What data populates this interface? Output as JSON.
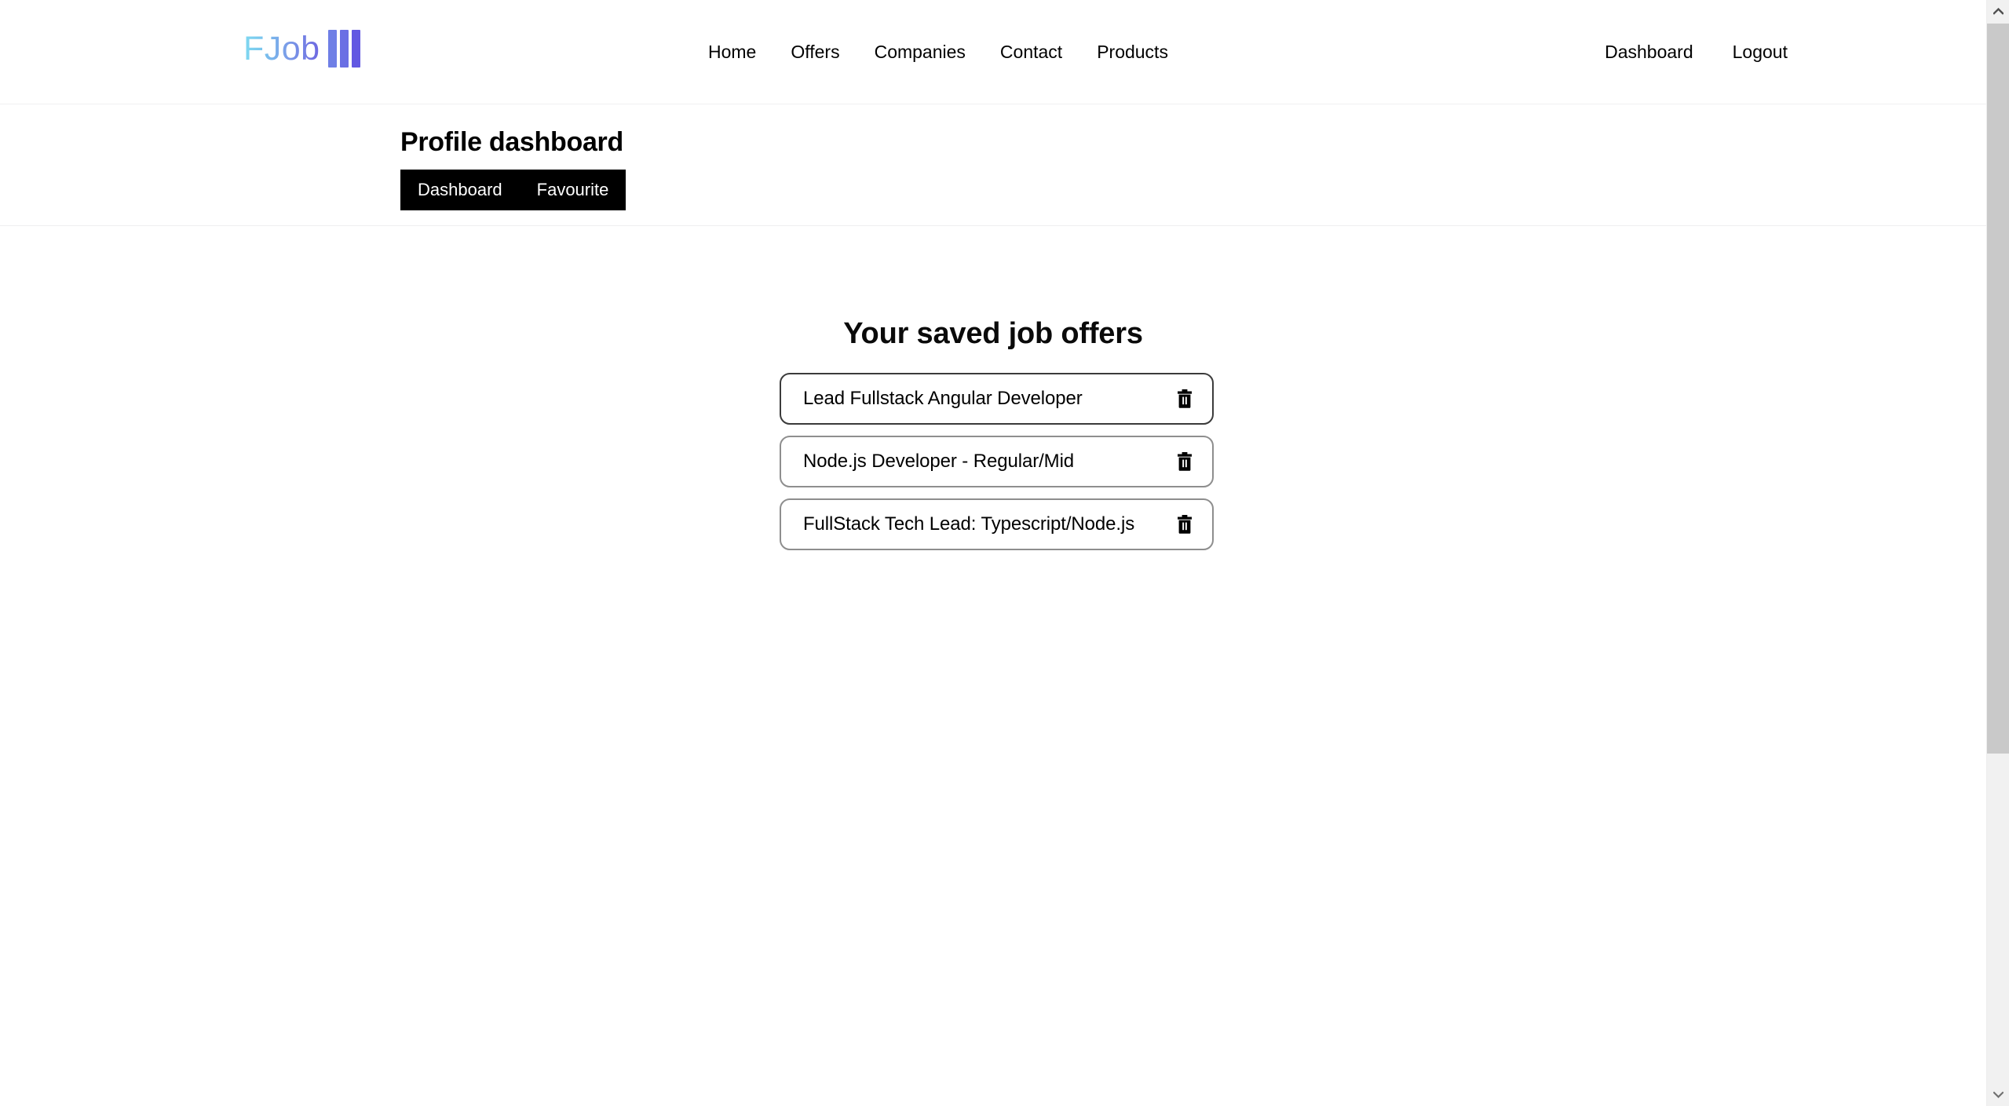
{
  "brand": {
    "name": "FJob",
    "bars": 3,
    "gradient_from": "#7fd9f0",
    "gradient_to": "#6258e2",
    "bar_colors": [
      "#6f7fe6",
      "#6a6fe4",
      "#6258e2"
    ]
  },
  "navbar": {
    "center_links": [
      {
        "label": "Home",
        "name": "nav-link-home"
      },
      {
        "label": "Offers",
        "name": "nav-link-offers"
      },
      {
        "label": "Companies",
        "name": "nav-link-companies"
      },
      {
        "label": "Contact",
        "name": "nav-link-contact"
      },
      {
        "label": "Products",
        "name": "nav-link-products"
      }
    ],
    "right_links": [
      {
        "label": "Dashboard",
        "name": "nav-link-dashboard"
      },
      {
        "label": "Logout",
        "name": "nav-link-logout"
      }
    ]
  },
  "profile": {
    "title": "Profile dashboard",
    "tabs": [
      {
        "label": "Dashboard",
        "name": "tab-dashboard"
      },
      {
        "label": "Favourite",
        "name": "tab-favourite"
      }
    ],
    "tabbar_background": "#000000",
    "tabbar_text_color": "#ffffff"
  },
  "main": {
    "heading": "Your saved job offers",
    "offers": [
      {
        "title": "Lead Fullstack Angular Developer",
        "delete_label": "trash-icon",
        "active": true
      },
      {
        "title": "Node.js Developer - Regular/Mid",
        "delete_label": "trash-icon",
        "active": false
      },
      {
        "title": "FullStack Tech Lead: Typescript/Node.js",
        "delete_label": "trash-icon",
        "active": false
      }
    ]
  },
  "scrollbar": {
    "up_icon": "chevron-up-icon",
    "down_icon": "chevron-down-icon",
    "track_color": "#f1f1f1",
    "thumb_color": "#c9c9c9"
  }
}
